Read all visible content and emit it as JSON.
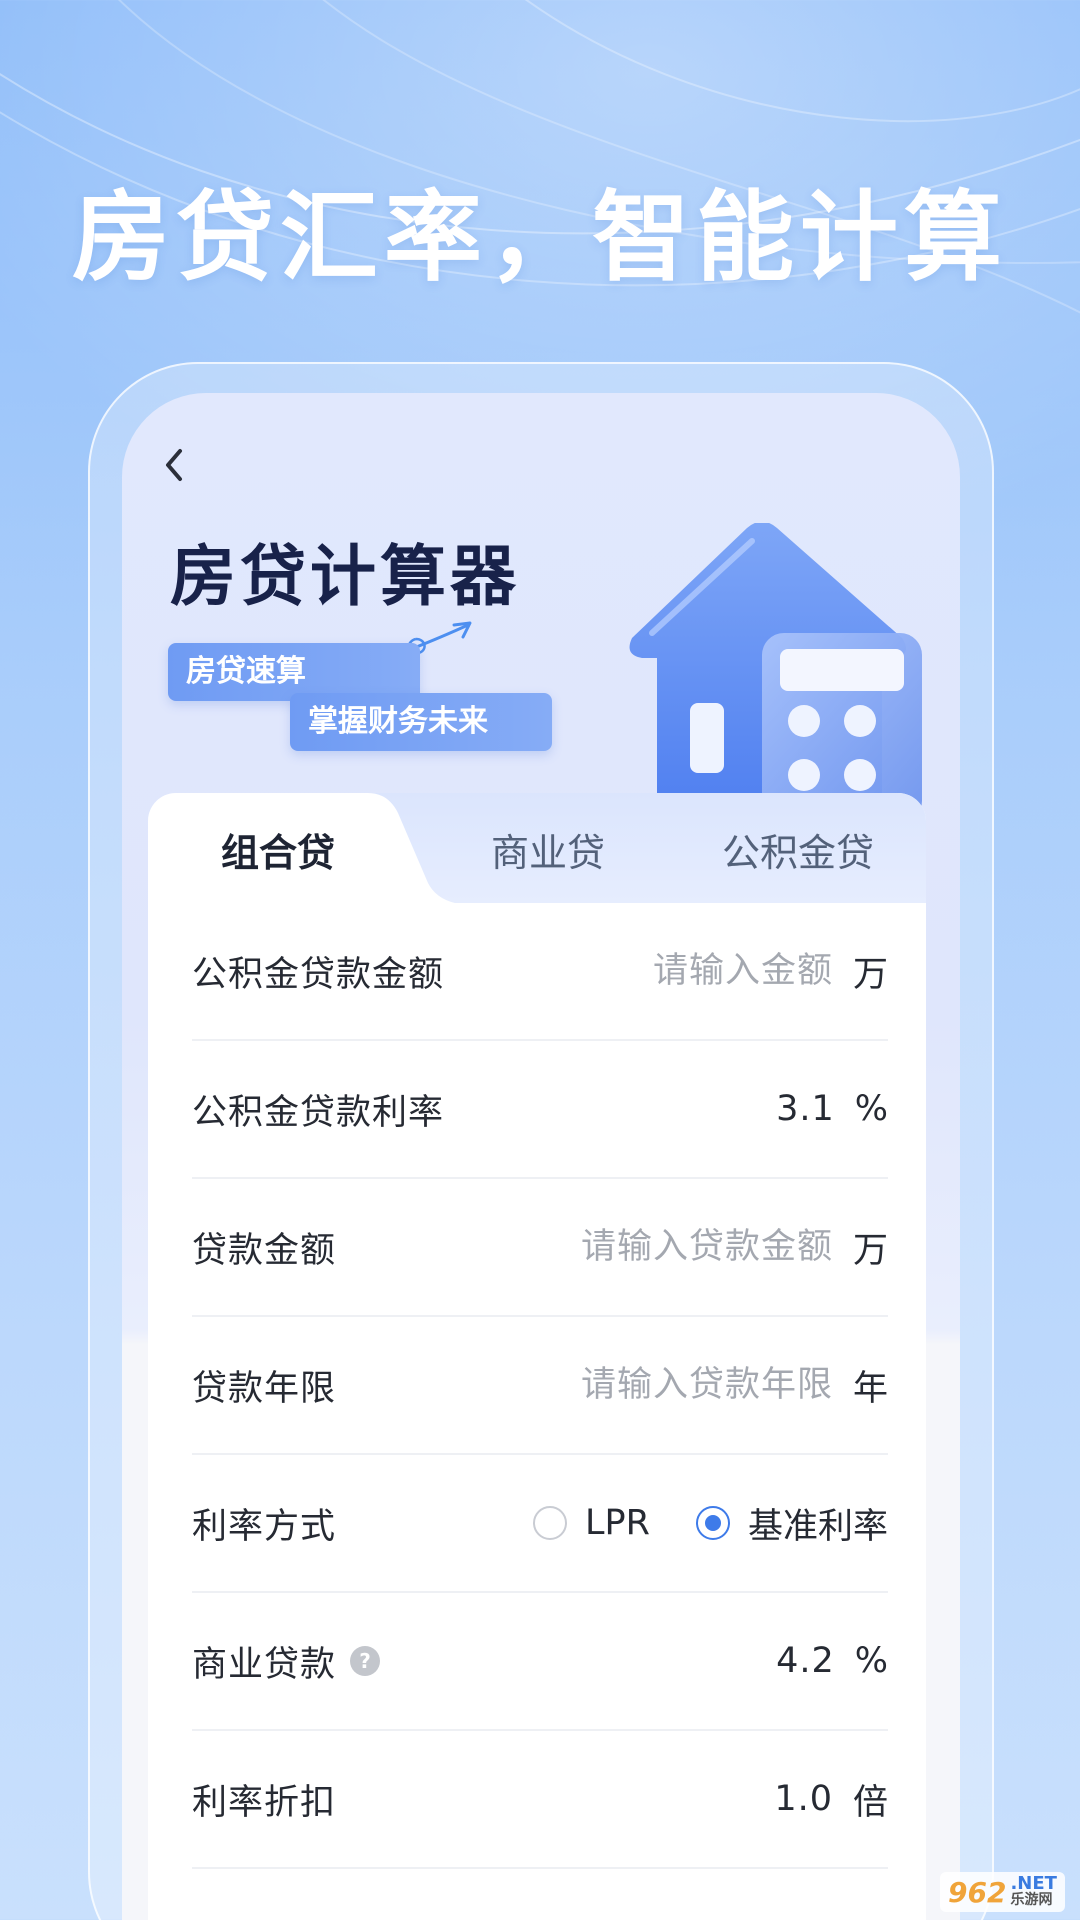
{
  "hero": {
    "title": "房贷汇率，智能计算"
  },
  "header": {
    "back_icon": "chevron-left-icon",
    "title": "房贷计算器",
    "tag_1": "房贷速算",
    "tag_2": "掌握财务未来"
  },
  "tabs": [
    {
      "label": "组合贷",
      "active": true
    },
    {
      "label": "商业贷",
      "active": false
    },
    {
      "label": "公积金贷",
      "active": false
    }
  ],
  "form": {
    "fund_amount": {
      "label": "公积金贷款金额",
      "value": "",
      "placeholder": "请输入金额",
      "unit": "万"
    },
    "fund_rate": {
      "label": "公积金贷款利率",
      "value": "3.1",
      "unit": "%"
    },
    "loan_amount": {
      "label": "贷款金额",
      "value": "",
      "placeholder": "请输入贷款金额",
      "unit": "万"
    },
    "loan_years": {
      "label": "贷款年限",
      "value": "",
      "placeholder": "请输入贷款年限",
      "unit": "年"
    },
    "rate_mode": {
      "label": "利率方式",
      "options": [
        {
          "label": "LPR",
          "selected": false
        },
        {
          "label": "基准利率",
          "selected": true
        }
      ]
    },
    "commercial_rate": {
      "label": "商业贷款",
      "help_icon": "question-icon",
      "help_glyph": "?",
      "value": "4.2",
      "unit": "%"
    },
    "rate_discount": {
      "label": "利率折扣",
      "value": "1.0",
      "unit": "倍"
    }
  },
  "watermark": {
    "logo": "962",
    "suffix": ".NET",
    "sub": "乐游网"
  },
  "colors": {
    "accent": "#3e7be9",
    "title_dark": "#18224a",
    "hero_text": "#ffffff"
  }
}
